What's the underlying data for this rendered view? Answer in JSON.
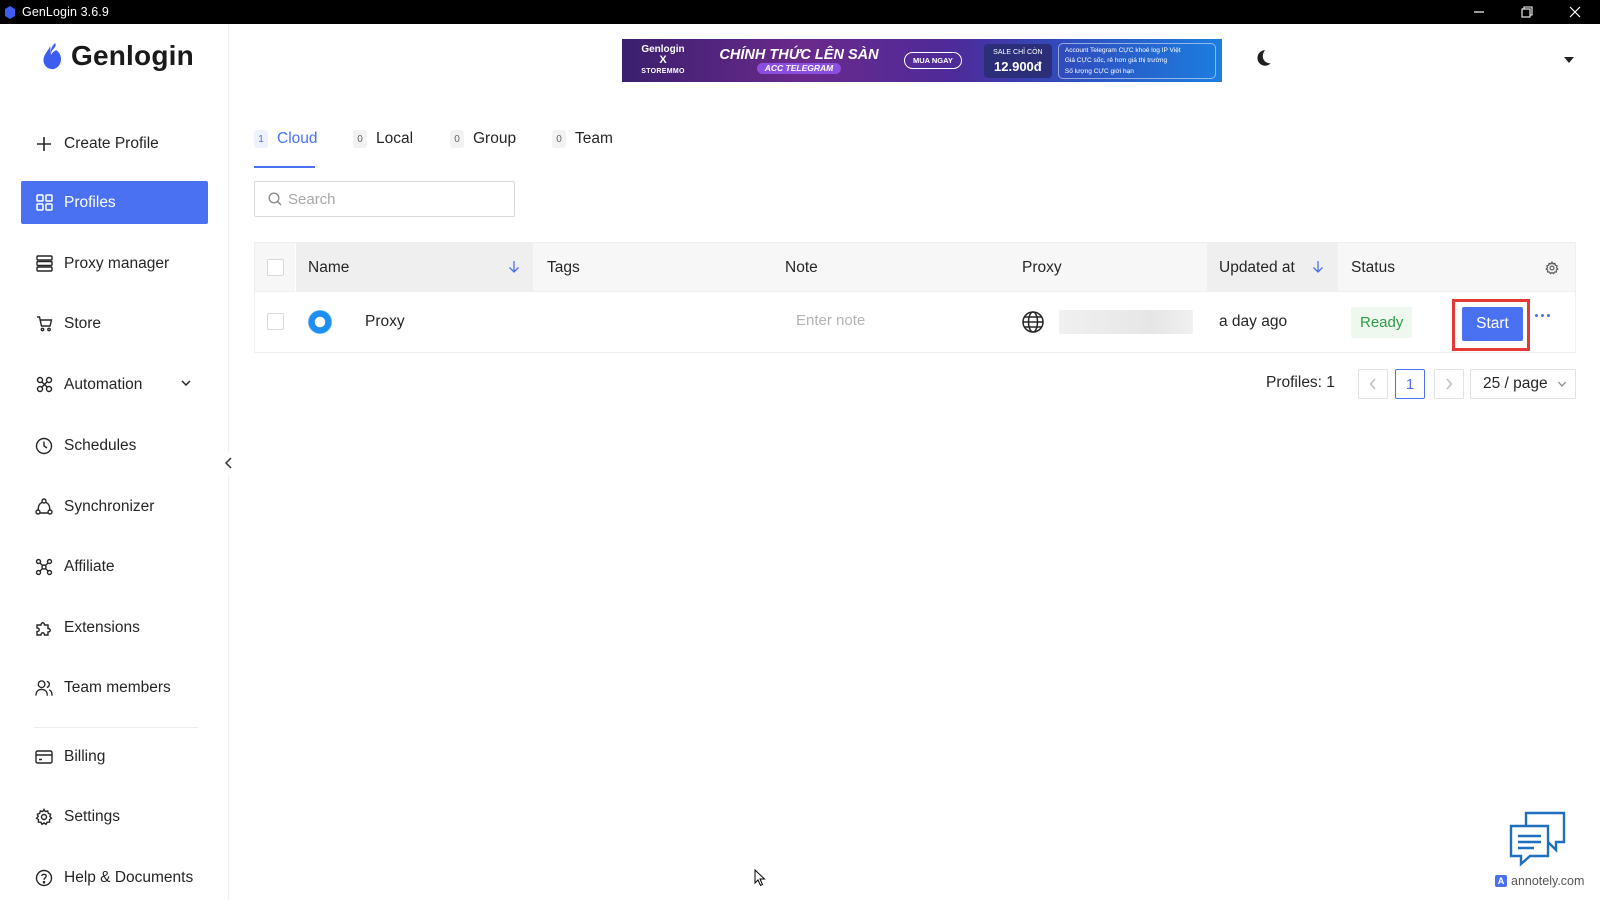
{
  "window": {
    "title": "GenLogin 3.6.9",
    "controls": [
      "minimize-icon",
      "restore-icon",
      "close-icon"
    ]
  },
  "brand": {
    "name": "Genlogin",
    "accent_color": "#4a71f2"
  },
  "sidebar": {
    "create_label": "Create Profile",
    "items": [
      {
        "id": "profiles",
        "label": "Profiles",
        "icon": "grid-icon",
        "active": true
      },
      {
        "id": "proxy-manager",
        "label": "Proxy manager",
        "icon": "server-icon"
      },
      {
        "id": "store",
        "label": "Store",
        "icon": "cart-icon"
      },
      {
        "id": "automation",
        "label": "Automation",
        "icon": "automation-icon",
        "expandable": true
      },
      {
        "id": "schedules",
        "label": "Schedules",
        "icon": "clock-icon"
      },
      {
        "id": "synchronizer",
        "label": "Synchronizer",
        "icon": "sync-icon"
      },
      {
        "id": "affiliate",
        "label": "Affiliate",
        "icon": "affiliate-icon"
      },
      {
        "id": "extensions",
        "label": "Extensions",
        "icon": "puzzle-icon"
      },
      {
        "id": "team-members",
        "label": "Team members",
        "icon": "users-icon"
      },
      {
        "id": "billing",
        "label": "Billing",
        "icon": "card-icon"
      },
      {
        "id": "settings",
        "label": "Settings",
        "icon": "gear-icon"
      },
      {
        "id": "help",
        "label": "Help & Documents",
        "icon": "help-icon"
      }
    ]
  },
  "banner": {
    "brand_top": "Genlogin",
    "brand_x": "X",
    "brand_bottom": "STOREMMO",
    "headline": "CHÍNH THỨC LÊN SÀN",
    "subline": "ACC TELEGRAM",
    "cta": "MUA NGAY",
    "price_label": "SALE CHỈ CÒN",
    "price": "12.900đ",
    "bullets": [
      "Account Telegram CỰC khoẻ log IP Việt",
      "Giá CỰC sốc, rẻ hơn giá thị trường",
      "Số lượng CỰC giới hạn"
    ]
  },
  "tabs": [
    {
      "count": "1",
      "label": "Cloud",
      "active": true
    },
    {
      "count": "0",
      "label": "Local"
    },
    {
      "count": "0",
      "label": "Group"
    },
    {
      "count": "0",
      "label": "Team"
    }
  ],
  "search": {
    "placeholder": "Search",
    "value": ""
  },
  "table": {
    "columns": {
      "name": "Name",
      "tags": "Tags",
      "note": "Note",
      "proxy": "Proxy",
      "updated_at": "Updated at",
      "status": "Status"
    },
    "rows": [
      {
        "name": "Proxy",
        "tags": "",
        "note_placeholder": "Enter note",
        "updated_at": "a day ago",
        "status": "Ready",
        "action": "Start"
      }
    ]
  },
  "pagination": {
    "total_label": "Profiles: 1",
    "current_page": "1",
    "page_size": "25 / page"
  },
  "watermark": "annotely.com"
}
